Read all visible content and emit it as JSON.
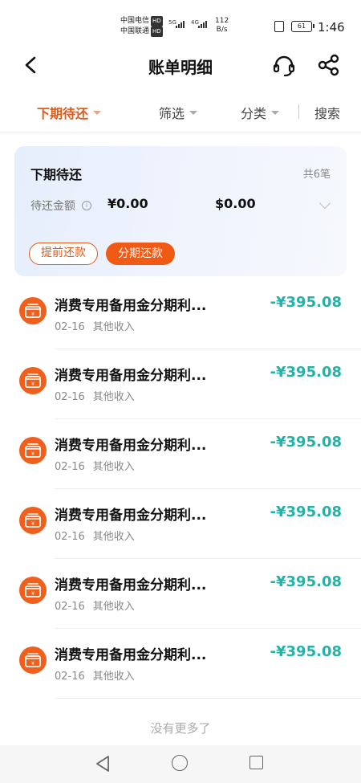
{
  "status_bar": {
    "carrier_1": "中国电信",
    "carrier_2": "中国联通",
    "hd_badge": "HD",
    "signal_1": "5G",
    "signal_2": "4G",
    "net_speed_value": "112",
    "net_speed_unit": "B/s",
    "battery": "61",
    "time": "1:46"
  },
  "header": {
    "title": "账单明细",
    "back_icon": "back-arrow-icon",
    "support_icon": "headset-icon",
    "share_icon": "share-icon"
  },
  "filters": {
    "period": "下期待还",
    "filter": "筛选",
    "category": "分类",
    "search": "搜索"
  },
  "summary": {
    "title": "下期待还",
    "count": "共6笔",
    "amount_label": "待还金额",
    "amount_cny": "¥0.00",
    "amount_usd": "$0.00",
    "prepay_button": "提前还款",
    "installment_button": "分期还款"
  },
  "transactions": [
    {
      "name": "消费专用备用金分期利...",
      "amount": "-¥395.08",
      "date": "02-16",
      "category": "其他收入"
    },
    {
      "name": "消费专用备用金分期利...",
      "amount": "-¥395.08",
      "date": "02-16",
      "category": "其他收入"
    },
    {
      "name": "消费专用备用金分期利...",
      "amount": "-¥395.08",
      "date": "02-16",
      "category": "其他收入"
    },
    {
      "name": "消费专用备用金分期利...",
      "amount": "-¥395.08",
      "date": "02-16",
      "category": "其他收入"
    },
    {
      "name": "消费专用备用金分期利...",
      "amount": "-¥395.08",
      "date": "02-16",
      "category": "其他收入"
    },
    {
      "name": "消费专用备用金分期利...",
      "amount": "-¥395.08",
      "date": "02-16",
      "category": "其他收入"
    }
  ],
  "footer": {
    "no_more": "没有更多了"
  },
  "colors": {
    "accent": "#f05a14",
    "amount": "#22b3a8"
  }
}
